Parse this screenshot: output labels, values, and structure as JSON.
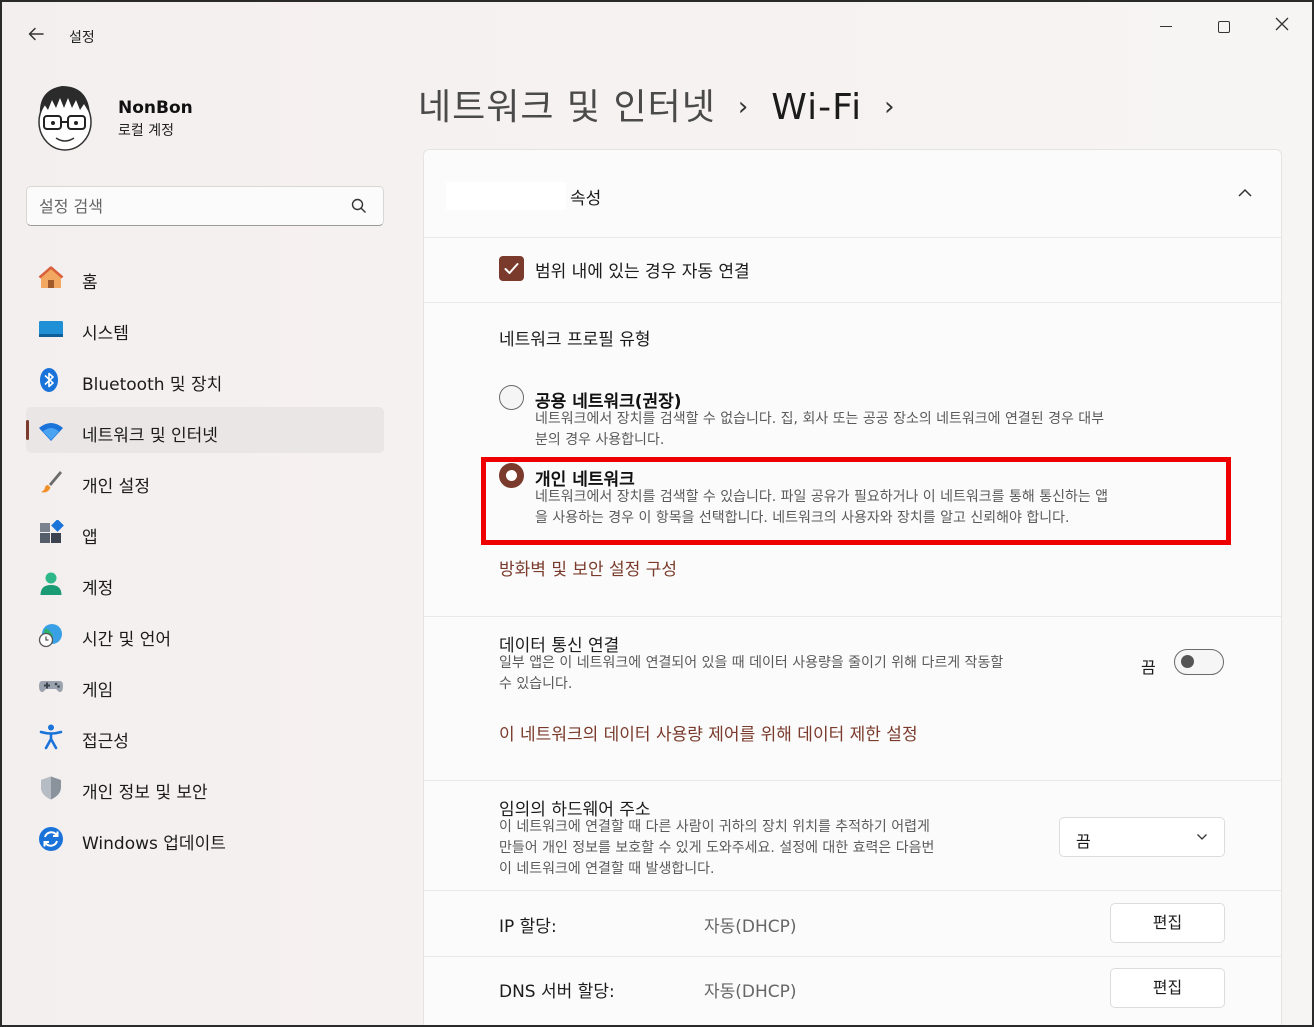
{
  "titlebar": {
    "back_icon": "arrow-left-icon",
    "title": "설정"
  },
  "profile": {
    "name": "NonBon",
    "account_type": "로컬 계정"
  },
  "search": {
    "placeholder": "설정 검색"
  },
  "nav": {
    "items": [
      {
        "label": "홈",
        "icon": "home-icon"
      },
      {
        "label": "시스템",
        "icon": "monitor-icon"
      },
      {
        "label": "Bluetooth 및 장치",
        "icon": "bluetooth-icon"
      },
      {
        "label": "네트워크 및 인터넷",
        "icon": "wifi-icon",
        "active": true
      },
      {
        "label": "개인 설정",
        "icon": "paintbrush-icon"
      },
      {
        "label": "앱",
        "icon": "apps-icon"
      },
      {
        "label": "계정",
        "icon": "person-icon"
      },
      {
        "label": "시간 및 언어",
        "icon": "clock-globe-icon"
      },
      {
        "label": "게임",
        "icon": "gamepad-icon"
      },
      {
        "label": "접근성",
        "icon": "accessibility-icon"
      },
      {
        "label": "개인 정보 및 보안",
        "icon": "shield-icon"
      },
      {
        "label": "Windows 업데이트",
        "icon": "update-icon"
      }
    ]
  },
  "breadcrumb": {
    "parent": "네트워크 및 인터넷",
    "current": "Wi-Fi",
    "separator": "›"
  },
  "card": {
    "title": "속성",
    "auto_connect": {
      "label": "범위 내에 있는 경우 자동 연결",
      "checked": true
    },
    "profile_type": {
      "label": "네트워크 프로필 유형",
      "public": {
        "title": "공용 네트워크(권장)",
        "desc_line1": "네트워크에서 장치를 검색할 수 없습니다. 집, 회사 또는 공공 장소의 네트워크에 연결된 경우 대부",
        "desc_line2": "분의 경우 사용합니다.",
        "selected": false
      },
      "private": {
        "title": "개인 네트워크",
        "desc_line1": "네트워크에서 장치를 검색할 수 있습니다. 파일 공유가 필요하거나 이 네트워크를 통해 통신하는 앱",
        "desc_line2": "을 사용하는 경우 이 항목을 선택합니다. 네트워크의 사용자와 장치를 알고 신뢰해야 합니다.",
        "selected": true
      }
    },
    "firewall_link": "방화벽 및 보안 설정 구성",
    "metered": {
      "title": "데이터 통신 연결",
      "desc_line1": "일부 앱은 이 네트워크에 연결되어 있을 때 데이터 사용량을 줄이기 위해 다르게 작동할",
      "desc_line2": "수 있습니다.",
      "toggle_label": "끔",
      "on": false
    },
    "data_limit_link": "이 네트워크의 데이터 사용량 제어를 위해 데이터 제한 설정",
    "random_hw": {
      "title": "임의의 하드웨어 주소",
      "desc_line1": "이 네트워크에 연결할 때 다른 사람이 귀하의 장치 위치를 추적하기 어렵게",
      "desc_line2": "만들어 개인 정보를 보호할 수 있게 도와주세요. 설정에 대한 효력은 다음번",
      "desc_line3": "이 네트워크에 연결할 때 발생합니다.",
      "value": "끔"
    },
    "ip": {
      "label": "IP 할당:",
      "value": "자동(DHCP)",
      "button": "편집"
    },
    "dns": {
      "label": "DNS 서버 할당:",
      "value": "자동(DHCP)",
      "button": "편집"
    }
  },
  "colors": {
    "accent": "#7a3b2c",
    "highlight": "#ee0000"
  }
}
